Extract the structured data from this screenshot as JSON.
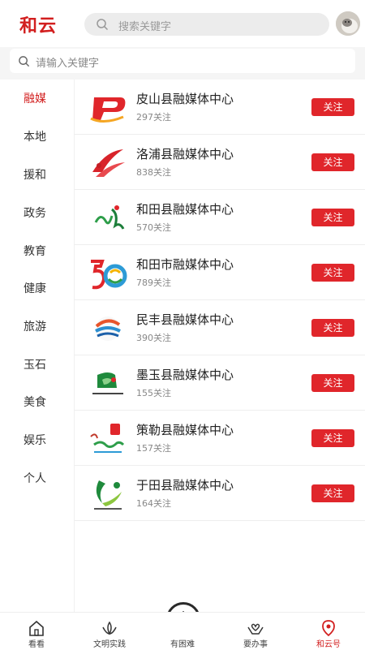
{
  "app": {
    "logo_text": "和云"
  },
  "header": {
    "search_placeholder": "搜索关键字"
  },
  "subsearch": {
    "placeholder": "请输入关键字"
  },
  "sidebar": {
    "items": [
      {
        "label": "融媒",
        "active": true
      },
      {
        "label": "本地",
        "active": false
      },
      {
        "label": "援和",
        "active": false
      },
      {
        "label": "政务",
        "active": false
      },
      {
        "label": "教育",
        "active": false
      },
      {
        "label": "健康",
        "active": false
      },
      {
        "label": "旅游",
        "active": false
      },
      {
        "label": "玉石",
        "active": false
      },
      {
        "label": "美食",
        "active": false
      },
      {
        "label": "娱乐",
        "active": false
      },
      {
        "label": "个人",
        "active": false
      }
    ]
  },
  "list": {
    "follow_label": "关注",
    "items": [
      {
        "title": "皮山县融媒体中心",
        "count": "297关注",
        "logo": "red-p-logo"
      },
      {
        "title": "洛浦县融媒体中心",
        "count": "838关注",
        "logo": "red-swoosh-logo"
      },
      {
        "title": "和田县融媒体中心",
        "count": "570关注",
        "logo": "green-calligraphy-logo"
      },
      {
        "title": "和田市融媒体中心",
        "count": "789关注",
        "logo": "colorful-50-logo"
      },
      {
        "title": "民丰县融媒体中心",
        "count": "390关注",
        "logo": "wave-circle-logo"
      },
      {
        "title": "墨玉县融媒体中心",
        "count": "155关注",
        "logo": "green-emblem-logo"
      },
      {
        "title": "策勒县融媒体中心",
        "count": "157关注",
        "logo": "calligraphy-seal-logo"
      },
      {
        "title": "于田县融媒体中心",
        "count": "164关注",
        "logo": "green-leaf-logo"
      }
    ]
  },
  "tabbar": {
    "items": [
      {
        "label": "看看",
        "icon": "home-icon",
        "active": false
      },
      {
        "label": "文明实践",
        "icon": "lotus-icon",
        "active": false
      },
      {
        "label": "有困难",
        "icon": "star-circle-icon",
        "active": false
      },
      {
        "label": "要办事",
        "icon": "hands-heart-icon",
        "active": false
      },
      {
        "label": "和云号",
        "icon": "location-pin-icon",
        "active": true
      }
    ]
  },
  "colors": {
    "accent": "#d21f1f",
    "follow_bg": "#e0262b"
  }
}
